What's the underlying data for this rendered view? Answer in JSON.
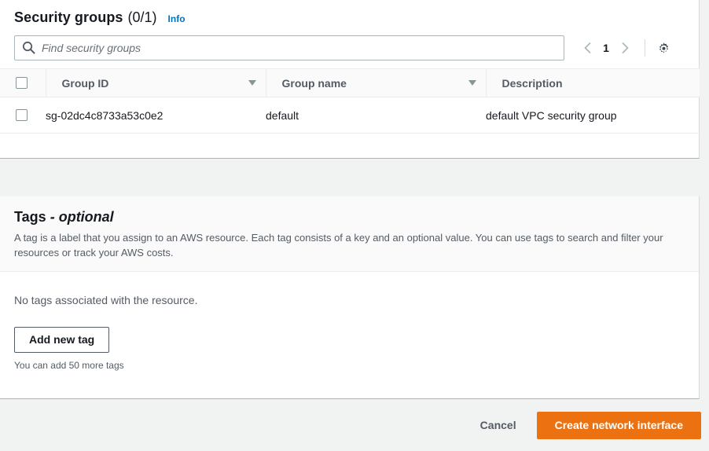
{
  "security_groups": {
    "title": "Security groups",
    "count": "(0/1)",
    "info_label": "Info",
    "search": {
      "placeholder": "Find security groups",
      "value": "",
      "icon": "search-icon"
    },
    "pagination": {
      "prev_icon": "chevron-left-icon",
      "page": "1",
      "next_icon": "chevron-right-icon",
      "settings_icon": "gear-icon"
    },
    "columns": [
      {
        "label": "Group ID",
        "sortable": true
      },
      {
        "label": "Group name",
        "sortable": true
      },
      {
        "label": "Description",
        "sortable": false
      }
    ],
    "rows": [
      {
        "group_id": "sg-02dc4c8733a53c0e2",
        "group_name": "default",
        "description": "default VPC security group",
        "selected": false
      }
    ]
  },
  "tags": {
    "title": "Tags",
    "title_suffix": "- optional",
    "description": "A tag is a label that you assign to an AWS resource. Each tag consists of a key and an optional value. You can use tags to search and filter your resources or track your AWS costs.",
    "empty_message": "No tags associated with the resource.",
    "add_button": "Add new tag",
    "hint": "You can add 50 more tags"
  },
  "footer": {
    "cancel_label": "Cancel",
    "submit_label": "Create network interface"
  },
  "colors": {
    "accent_orange": "#ec7211",
    "link_blue": "#0073bb",
    "page_background": "#f1f3f3",
    "panel_background": "#ffffff"
  }
}
